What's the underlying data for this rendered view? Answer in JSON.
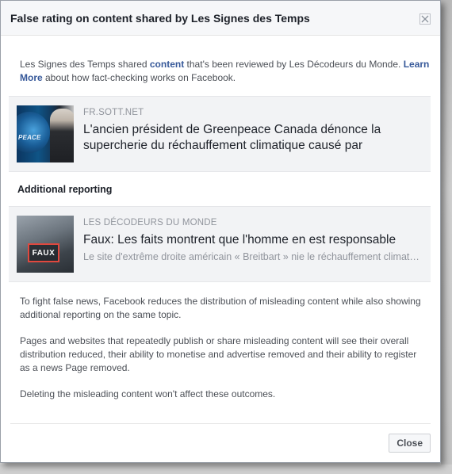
{
  "dialog": {
    "title": "False rating on content shared by Les Signes des Temps",
    "close_icon": "close-x-icon"
  },
  "intro": {
    "part1": "Les Signes des Temps shared ",
    "content_link": "content",
    "part2": " that's been reviewed by Les Décodeurs du Monde. ",
    "learn_more_link": "Learn More",
    "part3": " about how fact-checking works on Facebook."
  },
  "shared_article": {
    "source": "FR.SOTT.NET",
    "headline": "L'ancien président de Greenpeace Canada dénonce la supercherie du réchauffement climatique causé par",
    "thumbnail_text": "PEACE"
  },
  "additional": {
    "heading": "Additional reporting",
    "source": "LES DÉCODEURS DU MONDE",
    "headline": "Faux: Les faits montrent que l'homme en est responsable",
    "description": "Le site d'extrême droite américain « Breitbart » nie le réchauffement climatique",
    "thumbnail_badge": "FAUX"
  },
  "explanation": {
    "p1": "To fight false news, Facebook reduces the distribution of misleading content while also showing additional reporting on the same topic.",
    "p2": "Pages and websites that repeatedly publish or share misleading content will see their overall distribution reduced, their ability to monetise and advertise removed and their ability to register as a news Page removed.",
    "p3": "Deleting the misleading content won't affect these outcomes."
  },
  "footer": {
    "close_label": "Close"
  },
  "colors": {
    "link": "#365899",
    "badge_border": "#e0483e",
    "header_bg": "#f6f7f9",
    "card_bg": "#f2f3f5"
  }
}
